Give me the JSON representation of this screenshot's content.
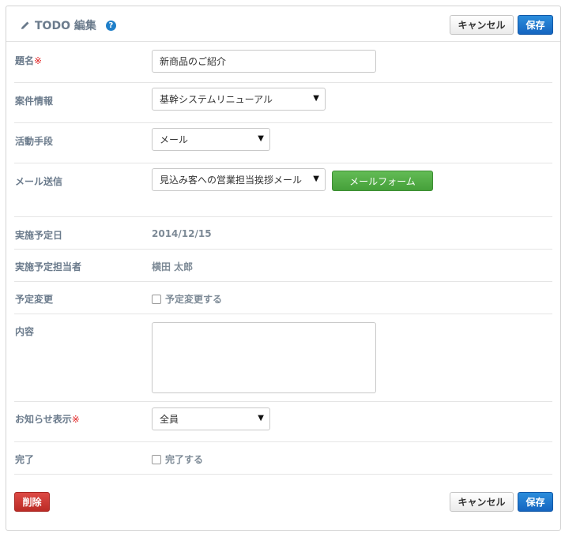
{
  "header": {
    "title": "TODO 編集",
    "cancel_label": "キャンセル",
    "save_label": "保存"
  },
  "form": {
    "subject": {
      "label": "題名",
      "required": "※",
      "value": "新商品のご紹介"
    },
    "project": {
      "label": "案件情報",
      "selected": "基幹システムリニューアル"
    },
    "method": {
      "label": "活動手段",
      "selected": "メール"
    },
    "mail": {
      "label": "メール送信",
      "selected": "見込み客への営業担当挨拶メール",
      "form_button": "メールフォーム"
    },
    "scheduled_date": {
      "label": "実施予定日",
      "value": "2014/12/15"
    },
    "assignee": {
      "label": "実施予定担当者",
      "value": "横田 太郎"
    },
    "change": {
      "label": "予定変更",
      "checkbox_label": "予定変更する"
    },
    "content": {
      "label": "内容",
      "value": ""
    },
    "notify": {
      "label": "お知らせ表示",
      "required": "※",
      "selected": "全員"
    },
    "done": {
      "label": "完了",
      "checkbox_label": "完了する"
    }
  },
  "footer": {
    "delete_label": "削除",
    "cancel_label": "キャンセル",
    "save_label": "保存"
  },
  "colors": {
    "primary": "#1565c0",
    "danger": "#bb2b26",
    "success": "#45a03a",
    "label": "#6b7b8c",
    "required": "#e02020"
  },
  "icons": [
    "pencil-icon",
    "help-icon",
    "caret-down-icon",
    "resize-icon"
  ]
}
